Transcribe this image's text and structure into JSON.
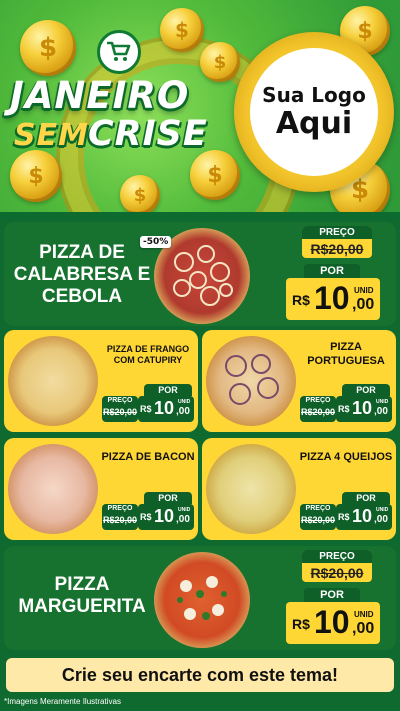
{
  "hero": {
    "title_line1": "JANEIRO",
    "title_sem": "SEM",
    "title_crise": "CRISE",
    "logo_line1": "Sua Logo",
    "logo_line2": "Aqui"
  },
  "currency": "R$",
  "unit_label": "UNID",
  "price_label": "PREÇO",
  "por_label": "POR",
  "products": [
    {
      "name": "PIZZA DE CALABRESA E CEBOLA",
      "badge": "-50%",
      "old_price": "R$20,00",
      "new_int": "10",
      "new_dec": ",00",
      "topping": "onion"
    },
    {
      "name": "PIZZA DE FRANGO COM CATUPIRY",
      "old_price": "R$20,00",
      "new_int": "10",
      "new_dec": ",00",
      "topping": "chicken"
    },
    {
      "name": "PIZZA PORTUGUESA",
      "old_price": "R$20,00",
      "new_int": "10",
      "new_dec": ",00",
      "topping": "portuguesa"
    },
    {
      "name": "PIZZA DE BACON",
      "old_price": "R$20,00",
      "new_int": "10",
      "new_dec": ",00",
      "topping": "bacon"
    },
    {
      "name": "PIZZA 4 QUEIJOS",
      "old_price": "R$20,00",
      "new_int": "10",
      "new_dec": ",00",
      "topping": "cheese"
    },
    {
      "name": "PIZZA MARGUERITA",
      "old_price": "R$20,00",
      "new_int": "10",
      "new_dec": ",00",
      "topping": "margherita"
    }
  ],
  "footer": {
    "cta": "Crie seu encarte com este tema!",
    "disclaimer": "*Imagens Meramente Ilustrativas"
  }
}
